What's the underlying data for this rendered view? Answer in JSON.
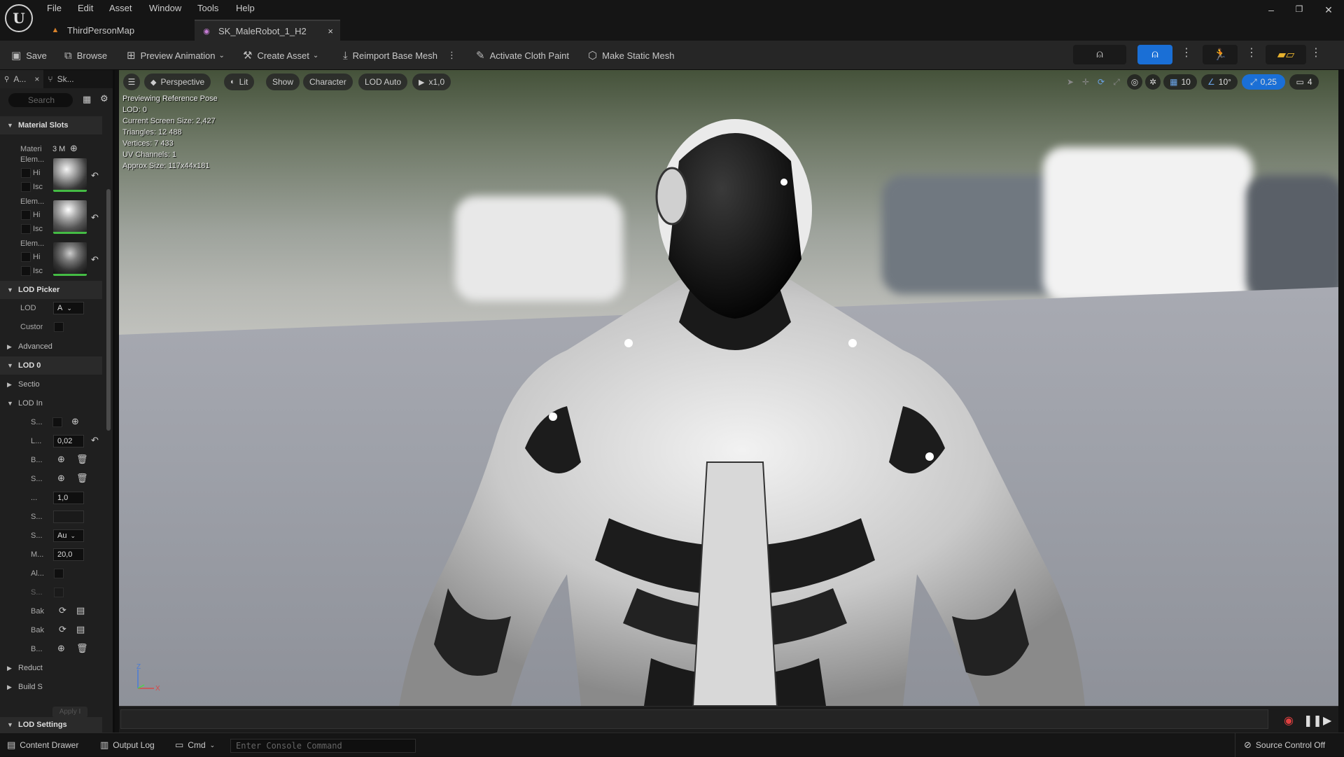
{
  "menu": [
    "File",
    "Edit",
    "Asset",
    "Window",
    "Tools",
    "Help"
  ],
  "tabs": [
    {
      "label": "ThirdPersonMap",
      "icon": "map-icon"
    },
    {
      "label": "SK_MaleRobot_1_H2",
      "icon": "skeletal-mesh-icon",
      "close": "×"
    }
  ],
  "toolbar": {
    "save": "Save",
    "browse": "Browse",
    "preview_animation": "Preview Animation",
    "create_asset": "Create Asset",
    "reimport": "Reimport Base Mesh",
    "cloth_paint": "Activate Cloth Paint",
    "static_mesh": "Make Static Mesh"
  },
  "left_panel": {
    "tab1": "A...",
    "tab2": "Sk...",
    "search_placeholder": "Search",
    "material_slots": "Material Slots",
    "materi": "Materi",
    "materi_count": "3 M",
    "elem": "Elem...",
    "hi": "Hi",
    "isc": "Isc",
    "lod_picker": "LOD Picker",
    "lod": "LOD",
    "lod_value": "A",
    "custom": "Custor",
    "advanced": "Advanced",
    "lod0": "LOD 0",
    "sectio": "Sectio",
    "lod_in": "LOD In",
    "s": "S...",
    "l": "L...",
    "l_value": "0,02",
    "b": "B...",
    "dots": "...",
    "dots_value": "1,0",
    "s_value": "Au",
    "m": "M...",
    "m_value": "20,0",
    "al": "Al...",
    "bak": "Bak",
    "reduct": "Reduct",
    "build_s": "Build S",
    "apply": "Apply I",
    "lod_settings": "LOD Settings"
  },
  "viewport": {
    "perspective": "Perspective",
    "lit": "Lit",
    "show": "Show",
    "character": "Character",
    "lod_auto": "LOD Auto",
    "speed": "x1,0",
    "grid": "10",
    "angle": "10°",
    "scale": "0,25",
    "camera": "4",
    "stats": [
      "Previewing Reference Pose",
      "LOD: 0",
      "Current Screen Size: 2,427",
      "Triangles: 12 488",
      "Vertices: 7 433",
      "UV Channels: 1",
      "Approx Size: 117x44x181"
    ],
    "axis_z": "Z",
    "axis_x": "X"
  },
  "statusbar": {
    "content_drawer": "Content Drawer",
    "output_log": "Output Log",
    "cmd": "Cmd",
    "console_placeholder": "Enter Console Command",
    "source_control": "Source Control Off"
  },
  "colors": {
    "accent": "#1a6fd6",
    "bg": "#1f1f1f",
    "toolbar": "#262626"
  }
}
